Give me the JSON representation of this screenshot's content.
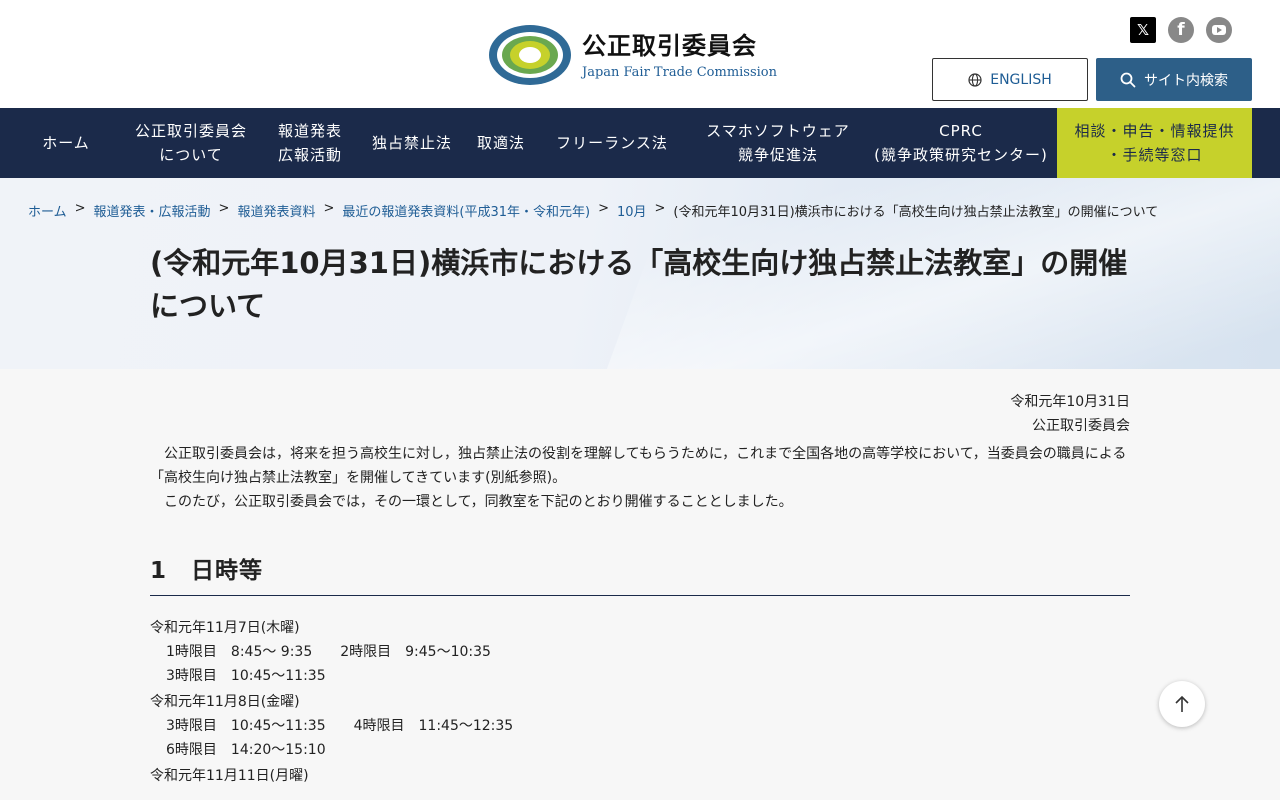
{
  "header": {
    "org_ja": "公正取引委員会",
    "org_en": "Japan Fair Trade Commission",
    "social": [
      {
        "icon": "x-icon",
        "glyph": "𝕏"
      },
      {
        "icon": "facebook-icon",
        "glyph": "f"
      },
      {
        "icon": "youtube-icon",
        "glyph": ""
      }
    ],
    "english_label": "ENGLISH",
    "search_label": "サイト内検索"
  },
  "nav": {
    "items": [
      {
        "label": "ホーム"
      },
      {
        "label": "公正取引委員会\nについて"
      },
      {
        "label": "報道発表\n広報活動"
      },
      {
        "label": "独占禁止法"
      },
      {
        "label": "取適法"
      },
      {
        "label": "フリーランス法"
      },
      {
        "label": "スマホソフトウェア\n競争促進法"
      },
      {
        "label": "CPRC\n(競争政策研究センター)"
      }
    ],
    "consult_label": "相談・申告・情報提供\n・手続等窓口"
  },
  "breadcrumb": {
    "items": [
      "ホーム",
      "報道発表・広報活動",
      "報道発表資料",
      "最近の報道発表資料(平成31年・令和元年)",
      "10月"
    ],
    "current": "(令和元年10月31日)横浜市における「高校生向け独占禁止法教室」の開催について",
    "separator": ">"
  },
  "page": {
    "title": "(令和元年10月31日)横浜市における「高校生向け独占禁止法教室」の開催について",
    "date": "令和元年10月31日",
    "issuer": "公正取引委員会",
    "paragraph1": "公正取引委員会は，将来を担う高校生に対し，独占禁止法の役割を理解してもらうために，これまで全国各地の高等学校において，当委員会の職員による「高校生向け独占禁止法教室」を開催してきています(別紙参照)。",
    "paragraph2": "このたび，公正取引委員会では，その一環として，同教室を下記のとおり開催することとしました。",
    "section1_title": "1　日時等",
    "schedule": [
      {
        "day": "令和元年11月7日(木曜)",
        "slots": [
          "1時限目　8:45～ 9:35　　2時限目　9:45～10:35",
          "3時限目　10:45～11:35"
        ]
      },
      {
        "day": "令和元年11月8日(金曜)",
        "slots": [
          "3時限目　10:45～11:35　　4時限目　11:45～12:35",
          "6時限目　14:20～15:10"
        ]
      },
      {
        "day": "令和元年11月11日(月曜)",
        "slots": []
      }
    ]
  },
  "colors": {
    "nav_bg": "#1b2a4a",
    "consult_bg": "#c6d12b",
    "search_btn": "#2d5f88",
    "link": "#1f5d95"
  }
}
